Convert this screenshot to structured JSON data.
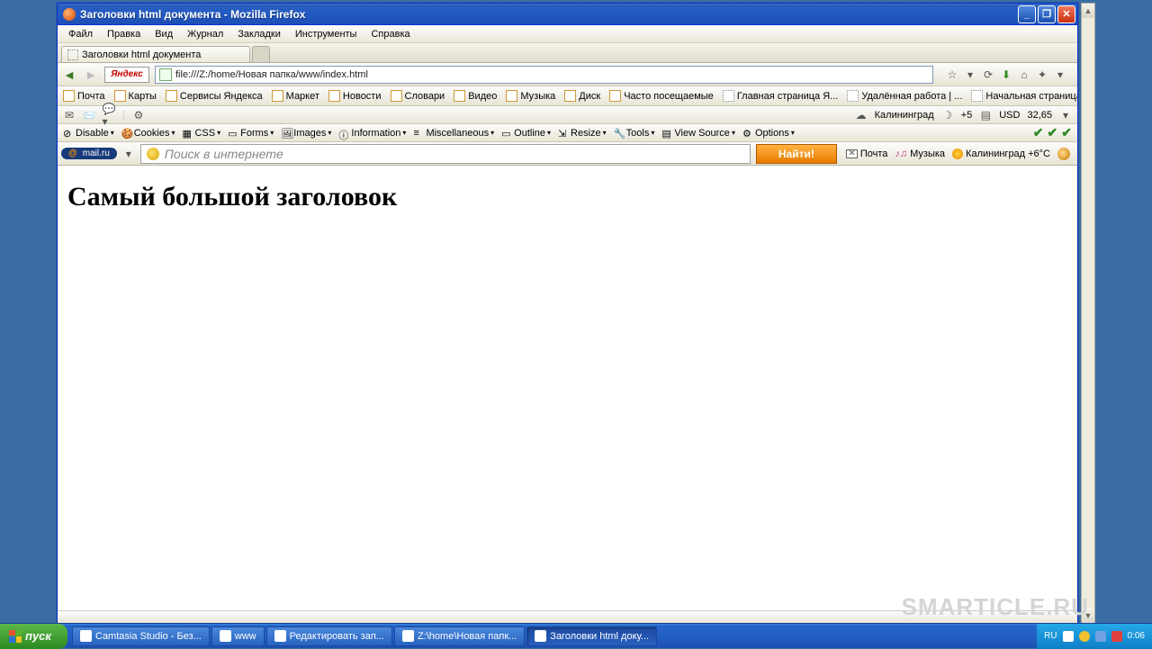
{
  "window": {
    "title": "Заголовки html документа - Mozilla Firefox"
  },
  "menubar": [
    "Файл",
    "Правка",
    "Вид",
    "Журнал",
    "Закладки",
    "Инструменты",
    "Справка"
  ],
  "tab": {
    "label": "Заголовки html документа"
  },
  "url": "file:///Z:/home/Новая папка/www/index.html",
  "yandex_logo": "Яндекс",
  "bookmarks": [
    {
      "label": "Почта",
      "type": "y"
    },
    {
      "label": "Карты",
      "type": "y"
    },
    {
      "label": "Сервисы Яндекса",
      "type": "y"
    },
    {
      "label": "Маркет",
      "type": "y"
    },
    {
      "label": "Новости",
      "type": "y"
    },
    {
      "label": "Словари",
      "type": "y"
    },
    {
      "label": "Видео",
      "type": "y"
    },
    {
      "label": "Музыка",
      "type": "y"
    },
    {
      "label": "Диск",
      "type": "y"
    },
    {
      "label": "Часто посещаемые",
      "type": "y"
    },
    {
      "label": "Главная страница Я...",
      "type": "page"
    },
    {
      "label": "Удалённая работа | ...",
      "type": "page"
    },
    {
      "label": "Начальная страница",
      "type": "page"
    }
  ],
  "weather_row": {
    "city": "Калининград",
    "temp": "+5",
    "currency_label": "USD",
    "currency_value": "32,65"
  },
  "devtools": [
    "Disable",
    "Cookies",
    "CSS",
    "Forms",
    "Images",
    "Information",
    "Miscellaneous",
    "Outline",
    "Resize",
    "Tools",
    "View Source",
    "Options"
  ],
  "mailru": {
    "badge": "@mail.ru",
    "placeholder": "Поиск в интернете",
    "find": "Найти!",
    "mail": "Почта",
    "music": "Музыка",
    "weather_city": "Калининград",
    "weather_temp": "+6°C"
  },
  "page": {
    "h1": "Самый большой заголовок"
  },
  "watermark": "SMARTICLE.RU",
  "taskbar": {
    "start": "пуск",
    "buttons": [
      "Camtasia Studio - Без...",
      "www",
      "Редактировать зап...",
      "Z:\\home\\Новая папк...",
      "Заголовки html доку..."
    ],
    "lang": "RU",
    "time": "0:06"
  }
}
